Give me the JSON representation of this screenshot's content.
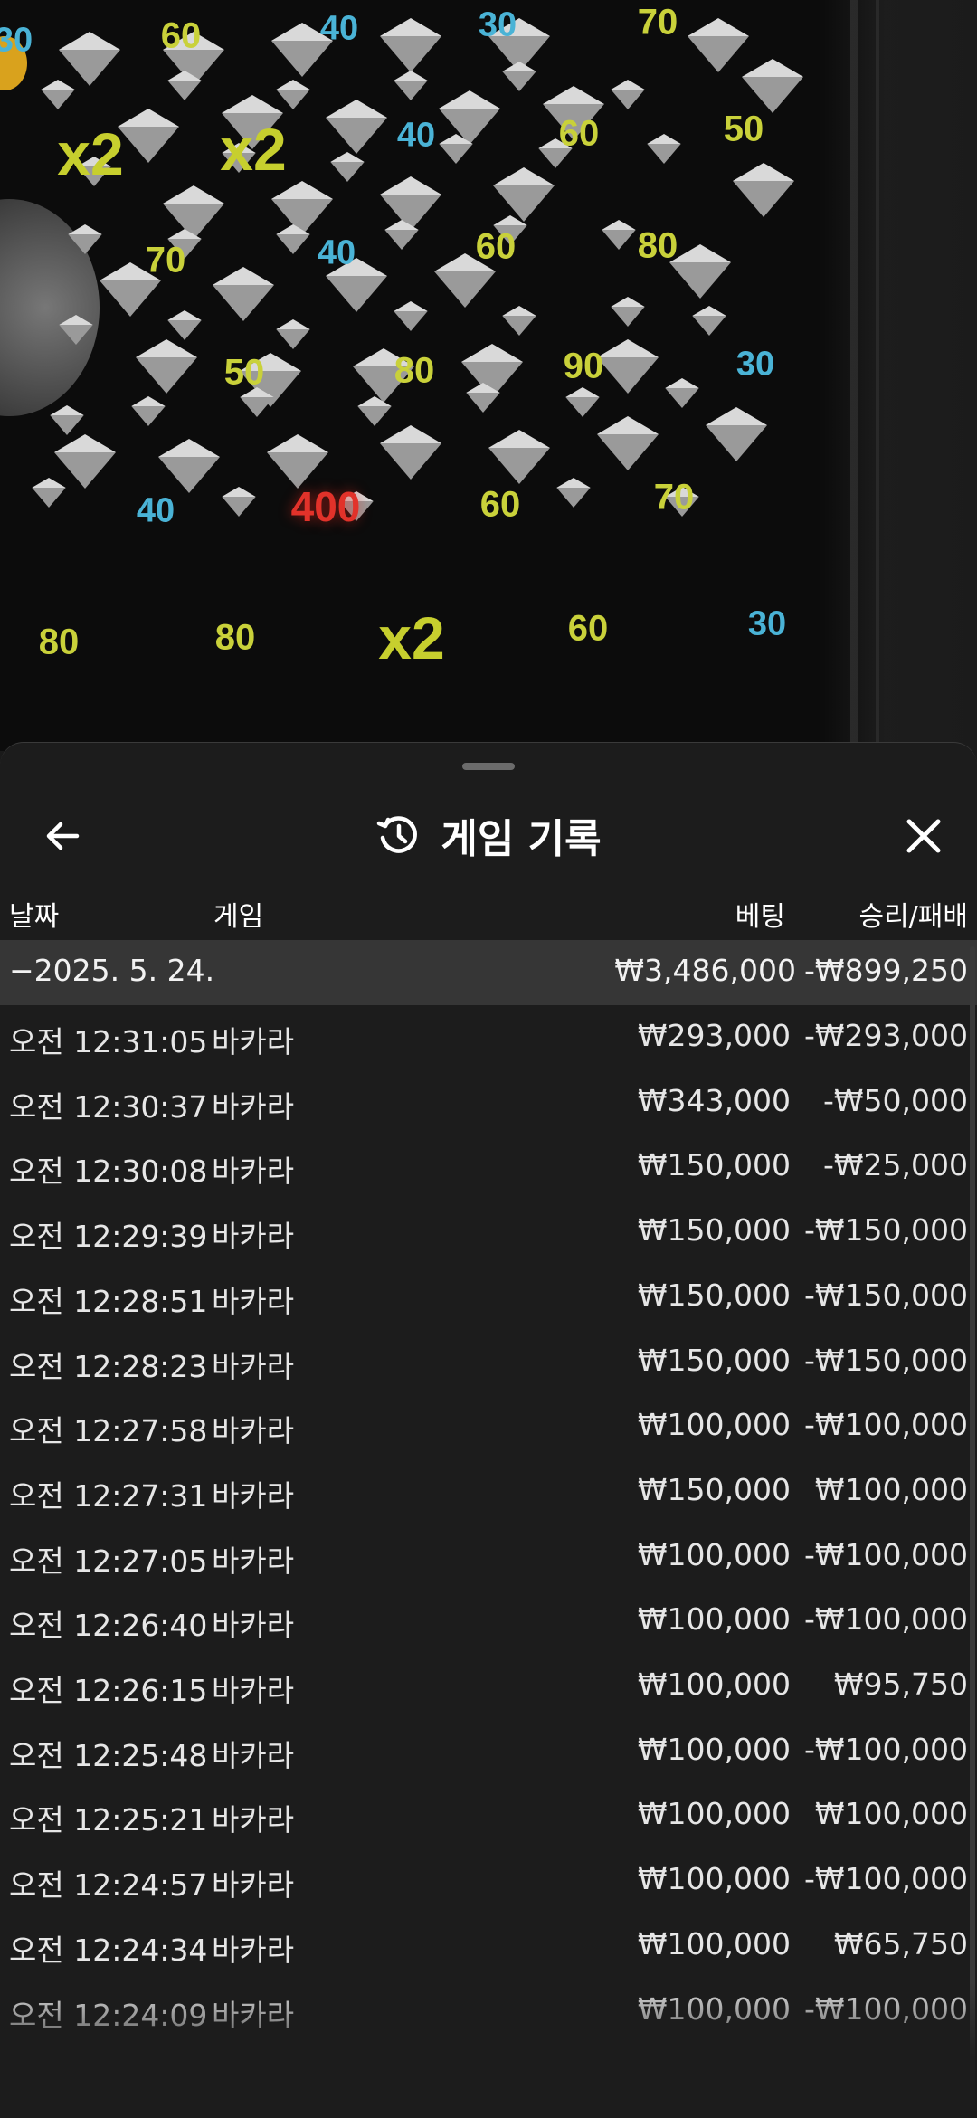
{
  "board": {
    "values": [
      {
        "t": "30",
        "c": "blue"
      },
      {
        "t": "60",
        "c": "yellow"
      },
      {
        "t": "40",
        "c": "blue"
      },
      {
        "t": "30",
        "c": "blue"
      },
      {
        "t": "70",
        "c": "yellow"
      },
      {
        "t": "x2",
        "c": "x2"
      },
      {
        "t": "x2",
        "c": "x2"
      },
      {
        "t": "40",
        "c": "blue"
      },
      {
        "t": "60",
        "c": "yellow"
      },
      {
        "t": "50",
        "c": "yellow"
      },
      {
        "t": "70",
        "c": "yellow"
      },
      {
        "t": "40",
        "c": "blue"
      },
      {
        "t": "60",
        "c": "yellow"
      },
      {
        "t": "80",
        "c": "yellow"
      },
      {
        "t": "50",
        "c": "yellow"
      },
      {
        "t": "80",
        "c": "yellow"
      },
      {
        "t": "90",
        "c": "yellow"
      },
      {
        "t": "30",
        "c": "blue"
      },
      {
        "t": "40",
        "c": "blue"
      },
      {
        "t": "400",
        "c": "red"
      },
      {
        "t": "60",
        "c": "yellow"
      },
      {
        "t": "70",
        "c": "yellow"
      },
      {
        "t": "80",
        "c": "yellow"
      },
      {
        "t": "80",
        "c": "yellow"
      },
      {
        "t": "x2",
        "c": "x2"
      },
      {
        "t": "60",
        "c": "yellow"
      },
      {
        "t": "30",
        "c": "blue"
      }
    ]
  },
  "sheet": {
    "title": "게임 기록",
    "back_icon": "arrow-left-icon",
    "history_icon": "history-icon",
    "close_icon": "close-icon",
    "columns": {
      "date": "날짜",
      "game": "게임",
      "bet": "베팅",
      "result": "승리/패배"
    },
    "group": {
      "date": "−2025. 5. 24.",
      "bet": "₩3,486,000",
      "result": "-₩899,250"
    },
    "rows": [
      {
        "time": "오전 12:31:05",
        "game": "바카라",
        "bet": "₩293,000",
        "result": "-₩293,000"
      },
      {
        "time": "오전 12:30:37",
        "game": "바카라",
        "bet": "₩343,000",
        "result": "-₩50,000"
      },
      {
        "time": "오전 12:30:08",
        "game": "바카라",
        "bet": "₩150,000",
        "result": "-₩25,000"
      },
      {
        "time": "오전 12:29:39",
        "game": "바카라",
        "bet": "₩150,000",
        "result": "-₩150,000"
      },
      {
        "time": "오전 12:28:51",
        "game": "바카라",
        "bet": "₩150,000",
        "result": "-₩150,000"
      },
      {
        "time": "오전 12:28:23",
        "game": "바카라",
        "bet": "₩150,000",
        "result": "-₩150,000"
      },
      {
        "time": "오전 12:27:58",
        "game": "바카라",
        "bet": "₩100,000",
        "result": "-₩100,000"
      },
      {
        "time": "오전 12:27:31",
        "game": "바카라",
        "bet": "₩150,000",
        "result": "₩100,000"
      },
      {
        "time": "오전 12:27:05",
        "game": "바카라",
        "bet": "₩100,000",
        "result": "-₩100,000"
      },
      {
        "time": "오전 12:26:40",
        "game": "바카라",
        "bet": "₩100,000",
        "result": "-₩100,000"
      },
      {
        "time": "오전 12:26:15",
        "game": "바카라",
        "bet": "₩100,000",
        "result": "₩95,750"
      },
      {
        "time": "오전 12:25:48",
        "game": "바카라",
        "bet": "₩100,000",
        "result": "-₩100,000"
      },
      {
        "time": "오전 12:25:21",
        "game": "바카라",
        "bet": "₩100,000",
        "result": "₩100,000"
      },
      {
        "time": "오전 12:24:57",
        "game": "바카라",
        "bet": "₩100,000",
        "result": "-₩100,000"
      },
      {
        "time": "오전 12:24:34",
        "game": "바카라",
        "bet": "₩100,000",
        "result": "₩65,750"
      },
      {
        "time": "오전 12:24:09",
        "game": "바카라",
        "bet": "₩100,000",
        "result": "-₩100,000"
      }
    ]
  }
}
